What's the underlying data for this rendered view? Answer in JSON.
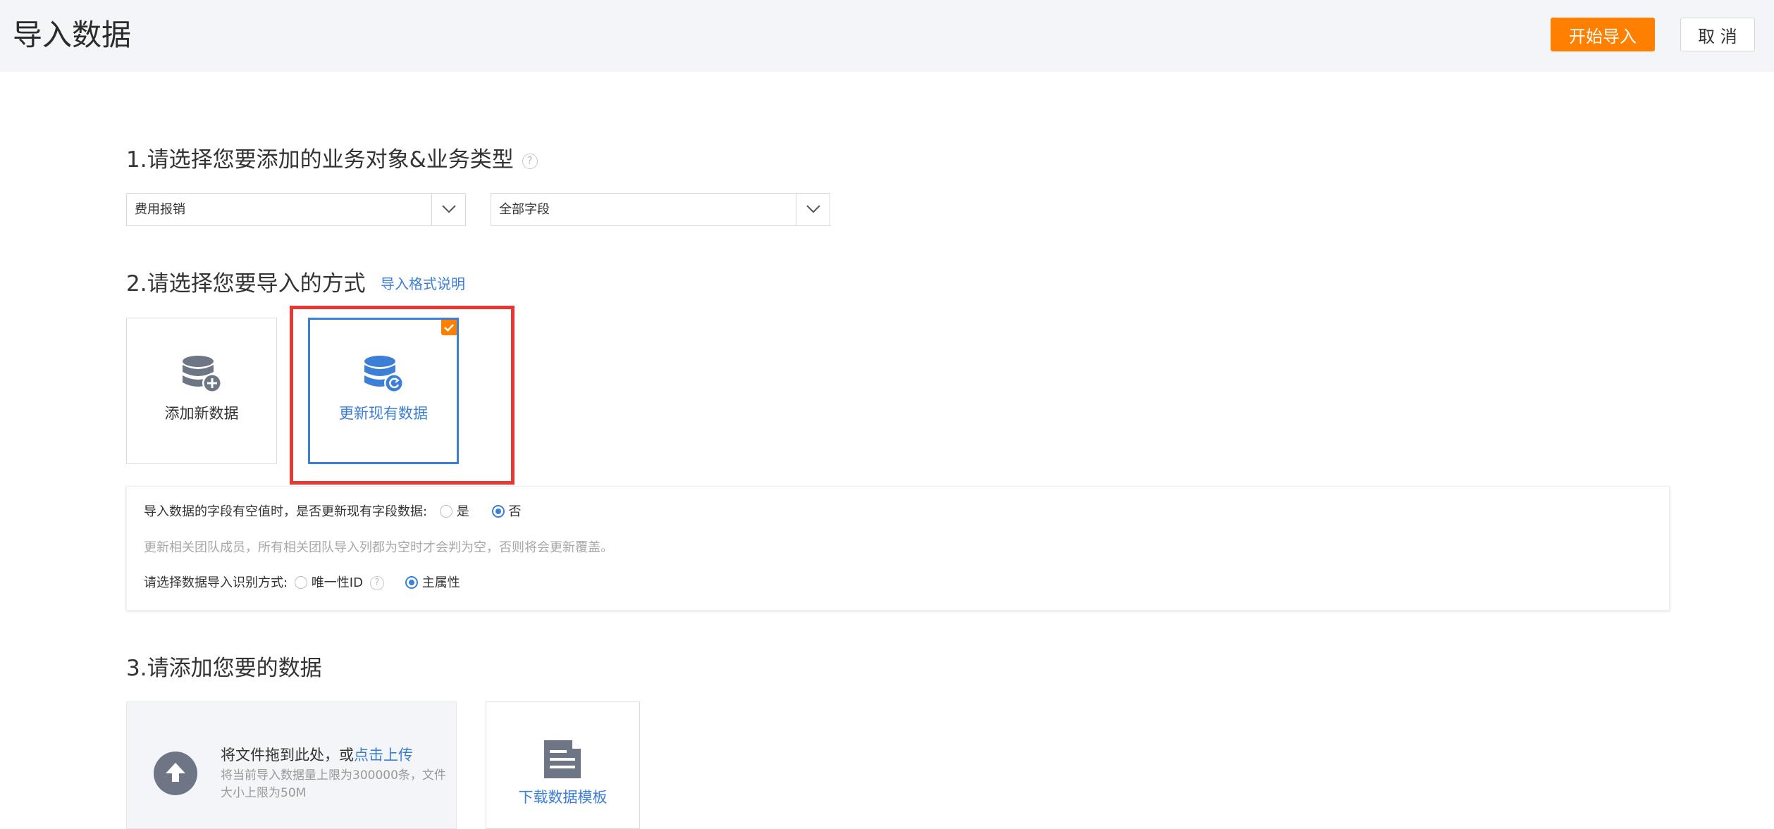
{
  "header": {
    "title": "导入数据",
    "start_button": "开始导入",
    "cancel_button": "取 消"
  },
  "step1": {
    "title": "1.请选择您要添加的业务对象&业务类型",
    "help": "?",
    "object_select": {
      "value": "费用报销",
      "icon": "chevron-down-icon"
    },
    "type_select": {
      "value": "全部字段",
      "icon": "chevron-down-icon"
    }
  },
  "step2": {
    "title": "2.请选择您要导入的方式",
    "format_link": "导入格式说明",
    "methods": [
      {
        "label": "添加新数据",
        "icon": "database-add-icon",
        "selected": false
      },
      {
        "label": "更新现有数据",
        "icon": "database-refresh-icon",
        "selected": true
      }
    ],
    "options": {
      "empty_value_question": "导入数据的字段有空值时，是否更新现有字段数据:",
      "empty_value_choices": [
        "是",
        "否"
      ],
      "empty_value_selected": "否",
      "note": "更新相关团队成员，所有相关团队导入列都为空时才会判为空，否则将会更新覆盖。",
      "identify_question": "请选择数据导入识别方式:",
      "identify_choices": [
        "唯一性ID",
        "主属性"
      ],
      "identify_help": "?",
      "identify_selected": "主属性"
    }
  },
  "step3": {
    "title": "3.请添加您要的数据",
    "drop_text": "将文件拖到此处，或",
    "upload_link": "点击上传",
    "limit_text": "将当前导入数据量上限为300000条，文件大小上限为50M",
    "template_label": "下载数据模板"
  },
  "colors": {
    "accent_orange": "#ff8000",
    "link_blue": "#3b7fd6",
    "highlight_red": "#e53935",
    "header_bg": "#f4f5f8"
  }
}
